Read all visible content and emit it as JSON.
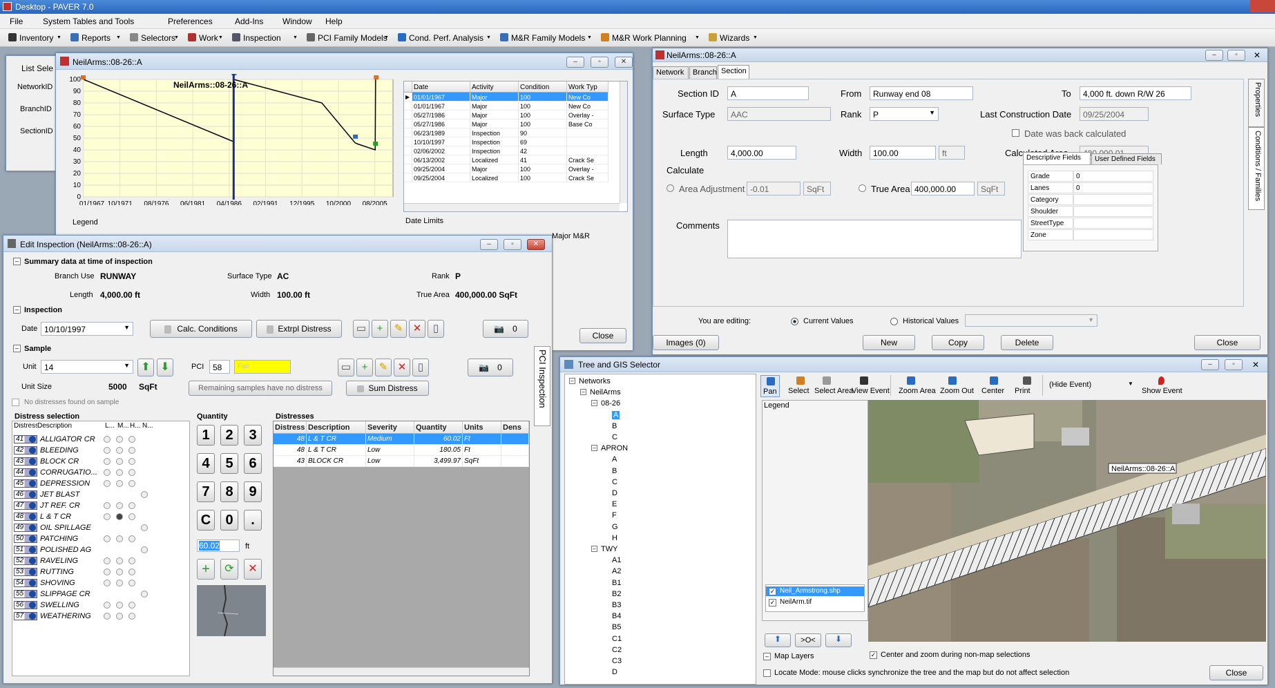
{
  "app": {
    "title": "Desktop - PAVER 7.0"
  },
  "menu": [
    "File",
    "System Tables and Tools",
    "Preferences",
    "Add-Ins",
    "Window",
    "Help"
  ],
  "toolbar": [
    "Inventory",
    "Reports",
    "Selectors",
    "Work",
    "Inspection",
    "PCI Family Models",
    "Cond. Perf. Analysis",
    "M&R Family Models",
    "M&R Work Planning",
    "Wizards"
  ],
  "listsel": {
    "title": "List Sele",
    "fields": [
      "NetworkID",
      "BranchID",
      "SectionID"
    ]
  },
  "chartwin": {
    "title": "NeilArms::08-26::A",
    "chart_title": "NeilArms::08-26::A",
    "legend_label": "Legend",
    "date_limits": "Date Limits",
    "major_mr": "Major M&R",
    "close": "Close",
    "columns": [
      "Date",
      "Activity",
      "Condition",
      "Work Typ"
    ],
    "rows": [
      [
        "01/01/1967",
        "Major",
        "100",
        "New Co"
      ],
      [
        "01/01/1967",
        "Major",
        "100",
        "New Co"
      ],
      [
        "05/27/1986",
        "Major",
        "100",
        "Overlay -"
      ],
      [
        "05/27/1986",
        "Major",
        "100",
        "Base Co"
      ],
      [
        "06/23/1989",
        "Inspection",
        "90",
        ""
      ],
      [
        "10/10/1997",
        "Inspection",
        "69",
        ""
      ],
      [
        "02/06/2002",
        "Inspection",
        "42",
        ""
      ],
      [
        "06/13/2002",
        "Localized",
        "41",
        "Crack Se"
      ],
      [
        "09/25/2004",
        "Major",
        "100",
        "Overlay -"
      ],
      [
        "09/25/2004",
        "Localized",
        "100",
        "Crack Se"
      ]
    ]
  },
  "chart_data": {
    "type": "line",
    "title": "NeilArms::08-26::A",
    "xlabel": "",
    "ylabel": "",
    "ylim": [
      0,
      100
    ],
    "yticks": [
      "100",
      "90",
      "80",
      "70",
      "60",
      "50",
      "40",
      "30",
      "20",
      "10",
      "0"
    ],
    "xticks": [
      "01/1967",
      "10/1971",
      "08/1976",
      "06/1981",
      "04/1986",
      "02/1991",
      "12/1995",
      "10/2000",
      "08/2005"
    ],
    "series": [
      {
        "points": [
          [
            1967.0,
            100
          ],
          [
            1986.4,
            47
          ],
          [
            1986.41,
            100
          ],
          [
            1997.8,
            80
          ],
          [
            2002.1,
            46
          ],
          [
            2002.45,
            45
          ],
          [
            2004.7,
            40
          ],
          [
            2004.75,
            100
          ]
        ]
      }
    ],
    "marker_year": 1986.4
  },
  "editinsp": {
    "title": "Edit Inspection (NeilArms::08-26::A)",
    "summary_hdr": "Summary data at time of inspection",
    "branch_use_label": "Branch Use",
    "branch_use": "RUNWAY",
    "surface_label": "Surface Type",
    "surface": "AC",
    "rank_label": "Rank",
    "rank": "P",
    "length_label": "Length",
    "length": "4,000.00 ft",
    "width_label": "Width",
    "width": "100.00 ft",
    "truearea_label": "True Area",
    "truearea": "400,000.00 SqFt",
    "inspection_hdr": "Inspection",
    "date_label": "Date",
    "date": "10/10/1997",
    "calc_btn": "Calc. Conditions",
    "extrpl_btn": "Extrpl Distress",
    "photo_count": "0",
    "sample_hdr": "Sample",
    "unit_label": "Unit",
    "unit": "14",
    "pci_label": "PCI",
    "pci": "58",
    "pci_rating": "Fair",
    "photo_count2": "0",
    "unitsize_label": "Unit Size",
    "unitsize": "5000",
    "unitsize_unit": "SqFt",
    "remaining": "Remaining samples have no distress",
    "sum_btn": "Sum Distress",
    "nodist": "No distresses found on sample",
    "distsel_hdr": "Distress selection",
    "distsel_cols": [
      "Distress",
      "Description",
      "L...",
      "M...",
      "H...",
      "N..."
    ],
    "distresses": [
      [
        "41",
        "ALLIGATOR CR"
      ],
      [
        "42",
        "BLEEDING"
      ],
      [
        "43",
        "BLOCK CR"
      ],
      [
        "44",
        "CORRUGATIO..."
      ],
      [
        "45",
        "DEPRESSION"
      ],
      [
        "46",
        "JET BLAST"
      ],
      [
        "47",
        "JT REF. CR"
      ],
      [
        "48",
        "L & T CR"
      ],
      [
        "49",
        "OIL SPILLAGE"
      ],
      [
        "50",
        "PATCHING"
      ],
      [
        "51",
        "POLISHED AG"
      ],
      [
        "52",
        "RAVELING"
      ],
      [
        "53",
        "RUTTING"
      ],
      [
        "54",
        "SHOVING"
      ],
      [
        "55",
        "SLIPPAGE CR"
      ],
      [
        "56",
        "SWELLING"
      ],
      [
        "57",
        "WEATHERING"
      ]
    ],
    "qty_hdr": "Quantity",
    "keys": [
      "1",
      "2",
      "3",
      "4",
      "5",
      "6",
      "7",
      "8",
      "9",
      "C",
      "0",
      "."
    ],
    "qty_value": "60.02",
    "qty_unit": "ft",
    "distresses_hdr": "Distresses",
    "dist_cols": [
      "Distress",
      "Description",
      "Severity",
      "Quantity",
      "Units",
      "Dens"
    ],
    "dist_rows": [
      [
        "48",
        "L & T CR",
        "Medium",
        "60.02",
        "Ft"
      ],
      [
        "48",
        "L & T CR",
        "Low",
        "180.05",
        "Ft"
      ],
      [
        "43",
        "BLOCK CR",
        "Low",
        "3,499.97",
        "SqFt"
      ]
    ],
    "side_tab": "PCI Inspection"
  },
  "section": {
    "title": "NeilArms::08-26::A",
    "tabs": [
      "Network",
      "Branch",
      "Section"
    ],
    "side_tabs": [
      "Properties",
      "Conditions / Families"
    ],
    "sectionid_label": "Section ID",
    "sectionid": "A",
    "from_label": "From",
    "from": "Runway end 08",
    "to_label": "To",
    "to": "4,000 ft. down R/W 26",
    "surface_label": "Surface Type",
    "surface": "AAC",
    "rank_label": "Rank",
    "rank": "P",
    "lcd_label": "Last Construction Date",
    "lcd": "09/25/2004",
    "backcalc": "Date was back calculated",
    "length_label": "Length",
    "length": "4,000.00",
    "width_label": "Width",
    "width": "100.00",
    "length_unit": "ft",
    "calcarea_label": "Calculated Area",
    "calcarea": "400,000.01",
    "calculate": "Calculate",
    "areaadj_label": "Area Adjustment",
    "areaadj": "-0.01",
    "sqft": "SqFt",
    "truearea_label": "True Area",
    "truearea": "400,000.00",
    "comments_label": "Comments",
    "desc_tabs": [
      "Descriptive Fields",
      "User Defined Fields"
    ],
    "fields": [
      [
        "Grade",
        "0"
      ],
      [
        "Lanes",
        "0"
      ],
      [
        "Category",
        ""
      ],
      [
        "Shoulder",
        ""
      ],
      [
        "StreetType",
        ""
      ],
      [
        "Zone",
        ""
      ]
    ],
    "editing_label": "You are editing:",
    "current": "Current Values",
    "historical": "Historical Values",
    "images_btn": "Images (0)",
    "new_btn": "New",
    "copy_btn": "Copy",
    "delete_btn": "Delete",
    "close_btn": "Close"
  },
  "gis": {
    "title": "Tree and GIS Selector",
    "tree": [
      {
        "t": "Networks",
        "l": 0
      },
      {
        "t": "NeilArms",
        "l": 1
      },
      {
        "t": "08-26",
        "l": 2
      },
      {
        "t": "A",
        "l": 3,
        "sel": true
      },
      {
        "t": "B",
        "l": 3
      },
      {
        "t": "C",
        "l": 3
      },
      {
        "t": "APRON",
        "l": 2
      },
      {
        "t": "A",
        "l": 3
      },
      {
        "t": "B",
        "l": 3
      },
      {
        "t": "C",
        "l": 3
      },
      {
        "t": "D",
        "l": 3
      },
      {
        "t": "E",
        "l": 3
      },
      {
        "t": "F",
        "l": 3
      },
      {
        "t": "G",
        "l": 3
      },
      {
        "t": "H",
        "l": 3
      },
      {
        "t": "TWY",
        "l": 2
      },
      {
        "t": "A1",
        "l": 3
      },
      {
        "t": "A2",
        "l": 3
      },
      {
        "t": "B1",
        "l": 3
      },
      {
        "t": "B2",
        "l": 3
      },
      {
        "t": "B3",
        "l": 3
      },
      {
        "t": "B4",
        "l": 3
      },
      {
        "t": "B5",
        "l": 3
      },
      {
        "t": "C1",
        "l": 3
      },
      {
        "t": "C2",
        "l": 3
      },
      {
        "t": "C3",
        "l": 3
      },
      {
        "t": "D",
        "l": 3
      }
    ],
    "tools": [
      "Pan",
      "Select",
      "Select Area",
      "View Event",
      "Zoom Area",
      "Zoom Out",
      "Center",
      "Print"
    ],
    "event_select": "(Hide Event)",
    "show_event": "Show Event",
    "legend": "Legend",
    "layers": [
      "Neil_Armstrong.shp",
      "NeilArm.tif"
    ],
    "layer_btn": ">O<",
    "map_layers": "Map Layers",
    "map_label": "NeilArms::08-26::A",
    "center_zoom": "Center and zoom during non-map selections",
    "locate": "Locate Mode: mouse clicks synchronize the tree and the map but do not affect selection",
    "close": "Close"
  }
}
